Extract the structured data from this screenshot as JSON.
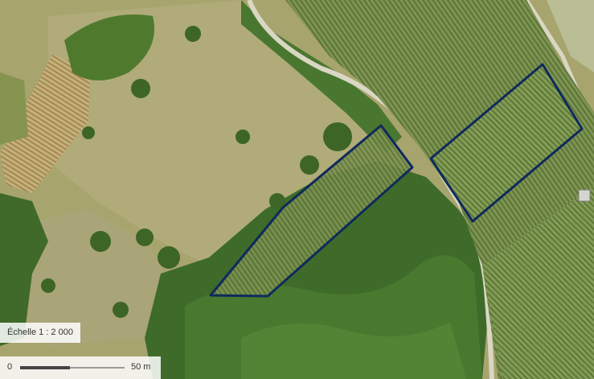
{
  "map": {
    "type": "aerial-orthophoto",
    "parcel_outline_color": "#0f2a5c",
    "parcels": [
      {
        "name": "parcel-west-vineyard"
      },
      {
        "name": "parcel-east-vineyard"
      }
    ]
  },
  "scale": {
    "label": "Échelle 1 : 2 000",
    "bar_start": "0",
    "bar_end": "50 m"
  }
}
